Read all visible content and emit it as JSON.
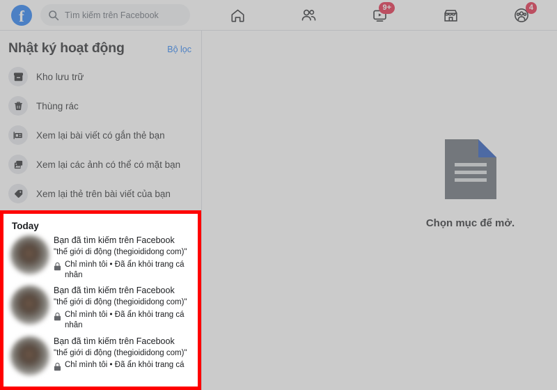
{
  "topbar": {
    "logo_letter": "f",
    "search": {
      "placeholder": "Tìm kiếm trên Facebook",
      "value": ""
    },
    "nav": [
      {
        "name": "home",
        "label": "Trang chủ",
        "badge": ""
      },
      {
        "name": "friends",
        "label": "Bạn bè",
        "badge": ""
      },
      {
        "name": "watch",
        "label": "Video",
        "badge": "9+"
      },
      {
        "name": "marketplace",
        "label": "Marketplace",
        "badge": ""
      },
      {
        "name": "groups",
        "label": "Nhóm",
        "badge": "4"
      }
    ]
  },
  "sidebar": {
    "title": "Nhật ký hoạt động",
    "filter_label": "Bộ lọc",
    "items": [
      {
        "icon": "archive-icon",
        "label": "Kho lưu trữ"
      },
      {
        "icon": "trash-icon",
        "label": "Thùng rác"
      },
      {
        "icon": "tagged-posts-icon",
        "label": "Xem lại bài viết có gắn thẻ bạn"
      },
      {
        "icon": "photos-icon",
        "label": "Xem lại các ảnh có thể có mặt bạn"
      },
      {
        "icon": "tag-icon",
        "label": "Xem lại thẻ trên bài viết của bạn"
      }
    ]
  },
  "activity": {
    "section_label": "Today",
    "entries": [
      {
        "title": "Bạn đã tìm kiếm trên Facebook",
        "quote": "\"thế giới di động (thegioididong com)\"",
        "meta": "Chỉ mình tôi • Đã ẩn khỏi trang cá nhân",
        "privacy_icon": "lock-icon"
      },
      {
        "title": "Bạn đã tìm kiếm trên Facebook",
        "quote": "\"thế giới di động (thegioididong com)\"",
        "meta": "Chỉ mình tôi • Đã ẩn khỏi trang cá nhân",
        "privacy_icon": "lock-icon"
      },
      {
        "title": "Bạn đã tìm kiếm trên Facebook",
        "quote": "\"thế giới di động (thegioididong com)\"",
        "meta": "Chỉ mình tôi • Đã ẩn khỏi trang cá",
        "privacy_icon": "lock-icon"
      }
    ]
  },
  "content": {
    "empty_text": "Chọn mục để mở.",
    "empty_icon": "document-icon"
  },
  "colors": {
    "brand_blue": "#1877f2",
    "badge_red": "#e41e3f",
    "highlight_red": "#ff0000",
    "doc_grey": "#606770",
    "doc_corner_blue": "#1b4fb8"
  }
}
